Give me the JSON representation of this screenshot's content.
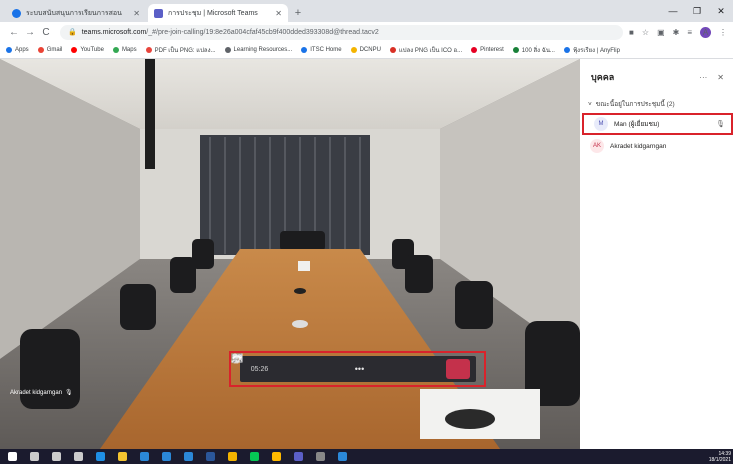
{
  "browser": {
    "tabs": [
      {
        "title": "ระบบสนับสนุนการเรียนการสอน",
        "active": false
      },
      {
        "title": "การประชุม | Microsoft Teams",
        "active": true
      }
    ],
    "new_tab_label": "+",
    "url_host": "teams.microsoft.com",
    "url_path": "/_#/pre-join-calling/19:8e26a004cfaf45cb9f400dded393308d@thread.tacv2",
    "profile_initial": "A",
    "bookmarks": [
      {
        "label": "Apps",
        "color": "#1a73e8"
      },
      {
        "label": "Gmail",
        "color": "#ea4335"
      },
      {
        "label": "YouTube",
        "color": "#ff0000"
      },
      {
        "label": "Maps",
        "color": "#34a853"
      },
      {
        "label": "PDF เป็น PNG: แปลง...",
        "color": "#e8453c"
      },
      {
        "label": "Learning Resources...",
        "color": "#5f6368"
      },
      {
        "label": "ITSC Home",
        "color": "#1a73e8"
      },
      {
        "label": "DCNPU",
        "color": "#f4b400"
      },
      {
        "label": "แปลง PNG เป็น ICO อ...",
        "color": "#d93025"
      },
      {
        "label": "Pinterest",
        "color": "#e60023"
      },
      {
        "label": "100 สิ่ง ฉัน...",
        "color": "#188038"
      },
      {
        "label": "ฟุ้งรเรียง | AnyFlip",
        "color": "#1a73e8"
      }
    ]
  },
  "video": {
    "participant_label": "Akradet kidgarngan"
  },
  "controls": {
    "timer": "05:26"
  },
  "panel": {
    "title": "บุคคล",
    "more": "···",
    "close": "✕",
    "section_label": "ขณะนี้อยู่ในการประชุมนี้ (2)",
    "people": [
      {
        "initials": "M",
        "name": "Man (ผู้เยี่ยมชม)",
        "avatar_bg": "#e8ebfa",
        "avatar_fg": "#4f52b2",
        "highlight": true
      },
      {
        "initials": "AK",
        "name": "Akradet kidgarngan",
        "avatar_bg": "#fde7e9",
        "avatar_fg": "#c4314b",
        "highlight": false
      }
    ]
  },
  "taskbar": {
    "time": "14:39",
    "date": "18/1/2021"
  },
  "colors": {
    "accent_red": "#d9232b",
    "teams_purple": "#5b5fc7",
    "hangup": "#c4314b"
  }
}
